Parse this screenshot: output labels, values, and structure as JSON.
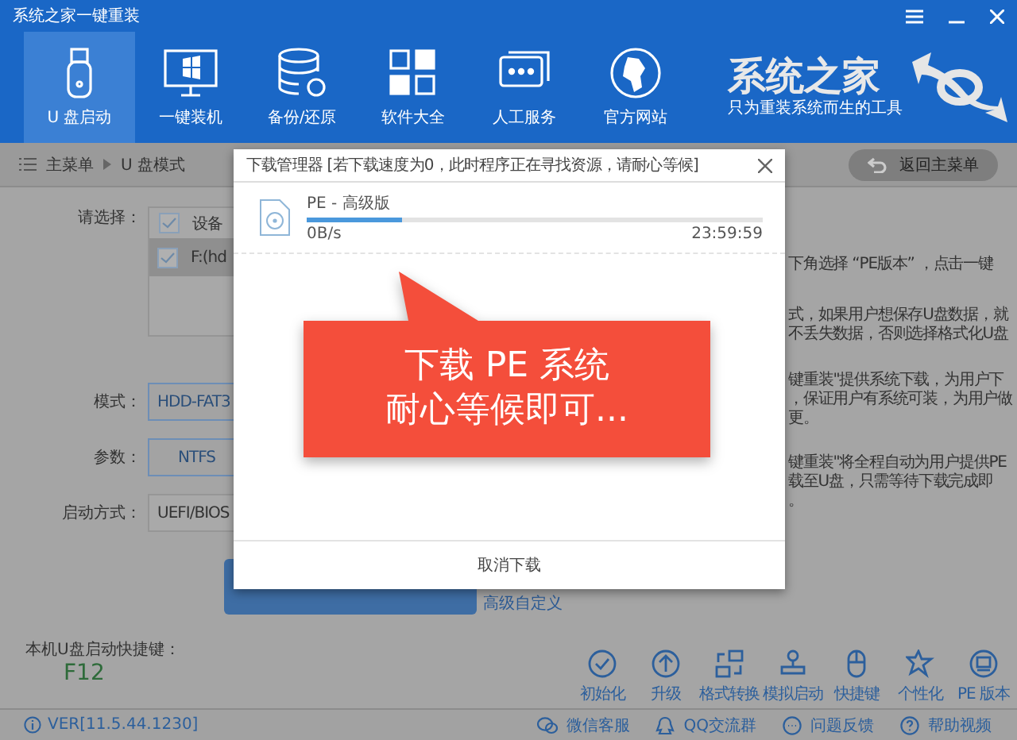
{
  "window": {
    "title": "系统之家一键重装"
  },
  "nav": [
    {
      "label": "U 盘启动",
      "selected": true
    },
    {
      "label": "一键装机",
      "selected": false
    },
    {
      "label": "备份/还原",
      "selected": false
    },
    {
      "label": "软件大全",
      "selected": false
    },
    {
      "label": "人工服务",
      "selected": false
    },
    {
      "label": "官方网站",
      "selected": false
    }
  ],
  "brand": {
    "name": "系统之家",
    "slogan": "只为重装系统而生的工具"
  },
  "breadcrumb": {
    "items": [
      "主菜单",
      "U 盘模式"
    ],
    "back_button": "返回主菜单"
  },
  "form": {
    "select_label": "请选择：",
    "devices": [
      {
        "text": "设备",
        "checked": true,
        "selected": false
      },
      {
        "text": "F:(hd",
        "checked": true,
        "selected": true
      }
    ],
    "mode_label": "模式：",
    "mode_value": "HDD-FAT3",
    "param_label": "参数：",
    "param_value": "NTFS",
    "boot_label": "启动方式：",
    "boot_value": "UEFI/BIOS",
    "link": "高级自定义"
  },
  "info_lines": [
    "下角选择 “PE版本” ，点击一键",
    "式，如果用户想保存U盘数据，就",
    "不丢失数据，否则选择格式化U盘",
    "键重装\"提供系统下载，为用户下",
    "，保证用户有系统可装，为用户做",
    "更。",
    "键重装\"将全程自动为用户提供PE",
    "载至U盘，只需等待下载完成即",
    "。"
  ],
  "hotkey": {
    "label": "本机U盘启动快捷键：",
    "value": "F12"
  },
  "tools": [
    {
      "label": "初始化"
    },
    {
      "label": "升级"
    },
    {
      "label": "格式转换"
    },
    {
      "label": "模拟启动"
    },
    {
      "label": "快捷键"
    },
    {
      "label": "个性化"
    },
    {
      "label": "PE 版本"
    }
  ],
  "status_bar": {
    "version": "VER[11.5.44.1230]",
    "links": [
      {
        "label": "微信客服"
      },
      {
        "label": "QQ交流群"
      },
      {
        "label": "问题反馈"
      },
      {
        "label": "帮助视频"
      }
    ]
  },
  "dialog": {
    "title": "下载管理器 [若下载速度为0，此时程序正在寻找资源，请耐心等候]",
    "item": {
      "name": "PE - 高级版",
      "level": 0.21,
      "speed": "0B/s",
      "remaining": "23:59:59"
    },
    "cancel_button": "取消下载",
    "callout": [
      "下载 PE 系统",
      "耐心等候即可..."
    ]
  }
}
